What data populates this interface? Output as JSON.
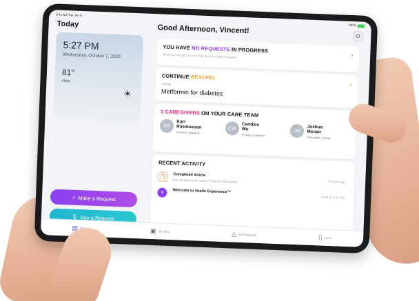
{
  "status_bar": {
    "time": "9:41 AM  Tue Jan 9",
    "battery": "100%"
  },
  "left": {
    "title": "Today",
    "weather": {
      "time": "5:27 PM",
      "date": "Wednesday, October 7, 2020",
      "temperature": "81°",
      "condition": "clear",
      "icon": "sun-icon"
    },
    "buttons": {
      "make_request": "Make a Request",
      "say_request": "Say a Request"
    }
  },
  "main": {
    "greeting": "Good Afternoon, Vincent!",
    "requests_card": {
      "title_prefix": "YOU HAVE ",
      "title_highlight": "NO REQUESTS",
      "title_suffix": " IN PROGRESS",
      "subtitle": "What can we get for you? Tap here to make a request."
    },
    "reading_card": {
      "title_prefix": "CONTINUE ",
      "title_highlight": "READING",
      "label": "Article",
      "article": "Metformin for diabetes"
    },
    "care_card": {
      "title_highlight": "3 CAREGIVERS",
      "title_suffix": " ON YOUR CARE TEAM",
      "caregivers": [
        {
          "initials": "KR",
          "first": "Kari",
          "last": "Rasmussen",
          "role": "Primary Caregiver"
        },
        {
          "initials": "CW",
          "first": "Candice",
          "last": "Wu",
          "role": "Primary Caregiver"
        },
        {
          "initials": "JM",
          "first": "Joshua",
          "last": "Mcnair",
          "role": "Secondary Caregi"
        }
      ]
    },
    "activity_card": {
      "title": "RECENT ACTIVITY",
      "items": [
        {
          "title": "Completed Article",
          "desc": "you completed the article \"Diabetic Neuropathy\"",
          "time": "5 hours ago  ›"
        },
        {
          "title": "Welcome to Voalte Experience™",
          "desc": "",
          "time": "Oct 8 at 3:44 PM  ›"
        }
      ]
    }
  },
  "tabs": [
    {
      "label": "Today",
      "icon": "calendar-icon",
      "active": true
    },
    {
      "label": "My Stay",
      "icon": "bed-icon",
      "active": false
    },
    {
      "label": "My Requests",
      "icon": "bell-icon",
      "active": false
    },
    {
      "label": "Learn",
      "icon": "book-icon",
      "active": false
    }
  ],
  "colors": {
    "accent_purple": "#8a3ff0",
    "accent_orange": "#f0a020",
    "accent_pink": "#e8287a",
    "button_teal": "#1fb6d1"
  }
}
